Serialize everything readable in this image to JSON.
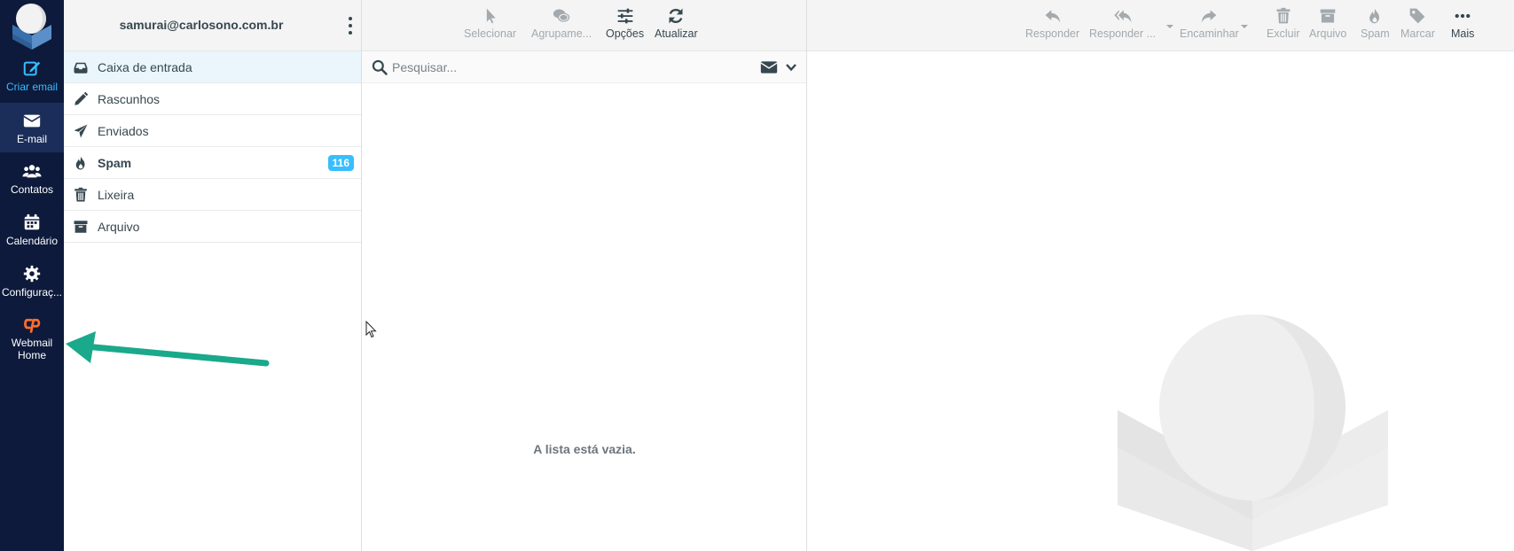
{
  "nav": {
    "compose_label": "Criar email",
    "mail_label": "E-mail",
    "contacts_label": "Contatos",
    "calendar_label": "Calendário",
    "settings_label": "Configuraç...",
    "cpanel_label": "Webmail Home"
  },
  "account": {
    "email": "samurai@carlosono.com.br"
  },
  "folders": [
    {
      "label": "Caixa de entrada",
      "icon": "inbox-icon",
      "selected": true
    },
    {
      "label": "Rascunhos",
      "icon": "pencil-icon"
    },
    {
      "label": "Enviados",
      "icon": "paper-plane-icon"
    },
    {
      "label": "Spam",
      "icon": "fire-icon",
      "unread": "116"
    },
    {
      "label": "Lixeira",
      "icon": "trash-icon"
    },
    {
      "label": "Arquivo",
      "icon": "archive-icon"
    }
  ],
  "list_toolbar": {
    "select": "Selecionar",
    "group": "Agrupame...",
    "options": "Opções",
    "refresh": "Atualizar"
  },
  "search": {
    "placeholder": "Pesquisar..."
  },
  "list": {
    "empty_text": "A lista está vazia."
  },
  "message_toolbar": {
    "reply": "Responder",
    "reply_all": "Responder ...",
    "forward": "Encaminhar",
    "delete": "Excluir",
    "archive": "Arquivo",
    "spam": "Spam",
    "mark": "Marcar",
    "more": "Mais"
  },
  "colors": {
    "nav_bg": "#0d1a3b",
    "accent": "#37beff",
    "annotation_arrow": "#1aa98a",
    "cpanel_orange": "#ff6c2c"
  }
}
